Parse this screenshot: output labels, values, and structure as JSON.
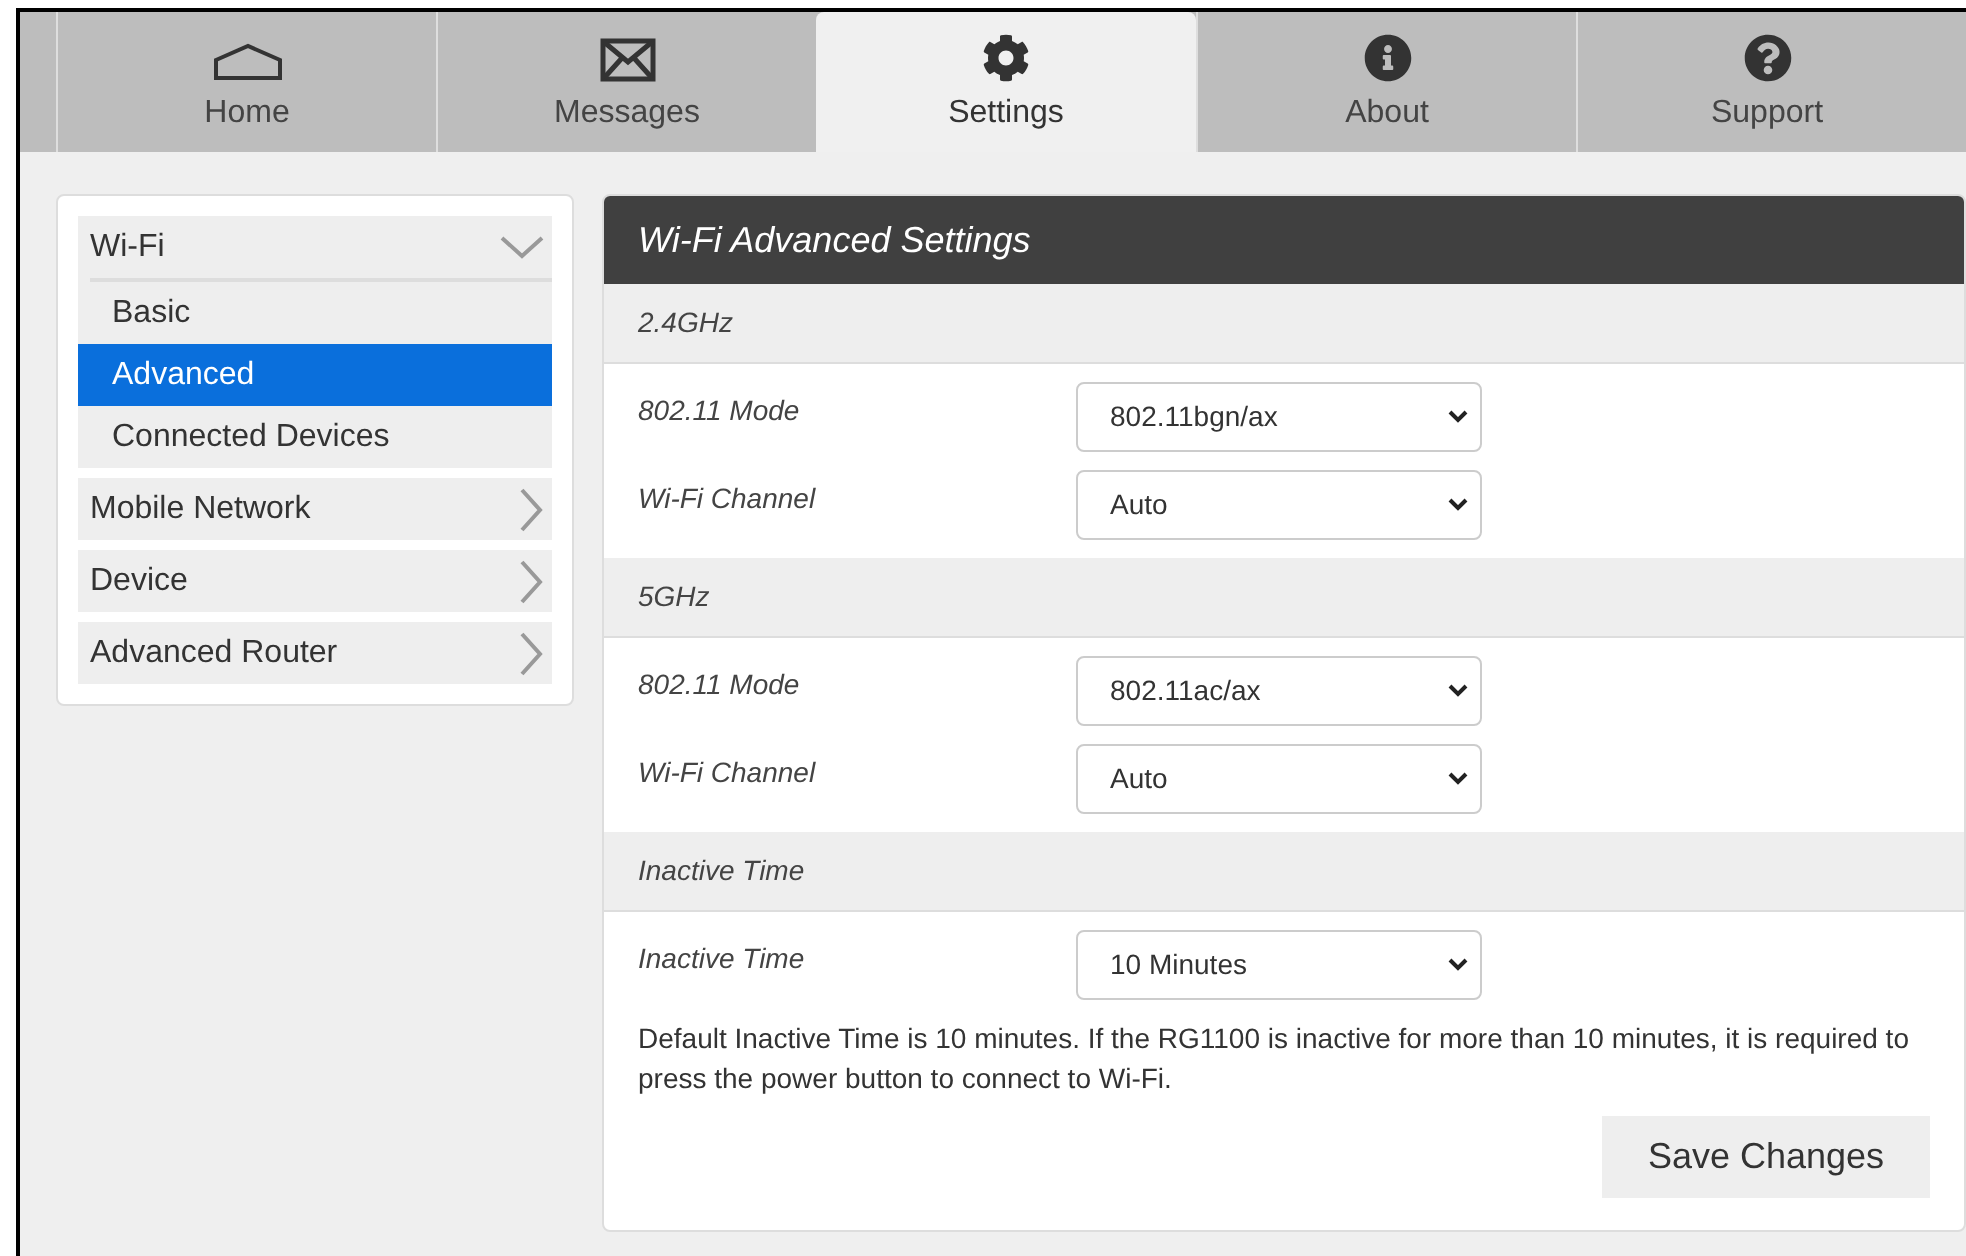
{
  "tabs": [
    {
      "label": "Home",
      "kind": "home",
      "selected": false
    },
    {
      "label": "Messages",
      "kind": "mail",
      "selected": false
    },
    {
      "label": "Settings",
      "kind": "gear",
      "selected": true
    },
    {
      "label": "About",
      "kind": "info",
      "selected": false
    },
    {
      "label": "Support",
      "kind": "help",
      "selected": false
    }
  ],
  "sidebar": {
    "items": [
      {
        "label": "Wi-Fi",
        "expanded": true,
        "children": [
          {
            "label": "Basic",
            "selected": false
          },
          {
            "label": "Advanced",
            "selected": true
          },
          {
            "label": "Connected Devices",
            "selected": false
          }
        ]
      },
      {
        "label": "Mobile Network",
        "expanded": false
      },
      {
        "label": "Device",
        "expanded": false
      },
      {
        "label": "Advanced Router",
        "expanded": false
      }
    ]
  },
  "panel": {
    "title": "Wi-Fi Advanced Settings",
    "sections": [
      {
        "heading": "2.4GHz",
        "fields": [
          {
            "label": "802.11 Mode",
            "value": "802.11bgn/ax"
          },
          {
            "label": "Wi-Fi Channel",
            "value": "Auto"
          }
        ]
      },
      {
        "heading": "5GHz",
        "fields": [
          {
            "label": "802.11 Mode",
            "value": "802.11ac/ax"
          },
          {
            "label": "Wi-Fi Channel",
            "value": "Auto"
          }
        ]
      },
      {
        "heading": "Inactive Time",
        "fields": [
          {
            "label": "Inactive Time",
            "value": "10 Minutes"
          }
        ],
        "note": "Default Inactive Time is 10 minutes. If the RG1100 is inactive for more than 10 minutes, it is required to press the power button to connect to Wi-Fi."
      }
    ],
    "save_button": "Save Changes"
  }
}
